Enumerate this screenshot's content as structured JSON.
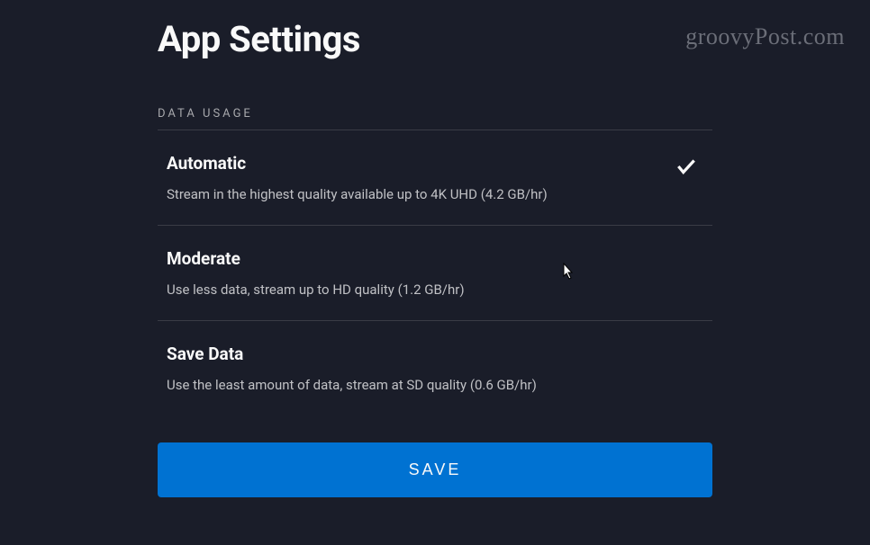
{
  "page": {
    "title": "App Settings"
  },
  "watermark": "groovyPost.com",
  "section": {
    "label": "DATA USAGE"
  },
  "options": [
    {
      "title": "Automatic",
      "description": "Stream in the highest quality available up to 4K UHD (4.2 GB/hr)",
      "selected": true
    },
    {
      "title": "Moderate",
      "description": "Use less data, stream up to HD quality (1.2 GB/hr)",
      "selected": false
    },
    {
      "title": "Save Data",
      "description": "Use the least amount of data, stream at SD quality (0.6 GB/hr)",
      "selected": false
    }
  ],
  "buttons": {
    "save": "SAVE"
  }
}
